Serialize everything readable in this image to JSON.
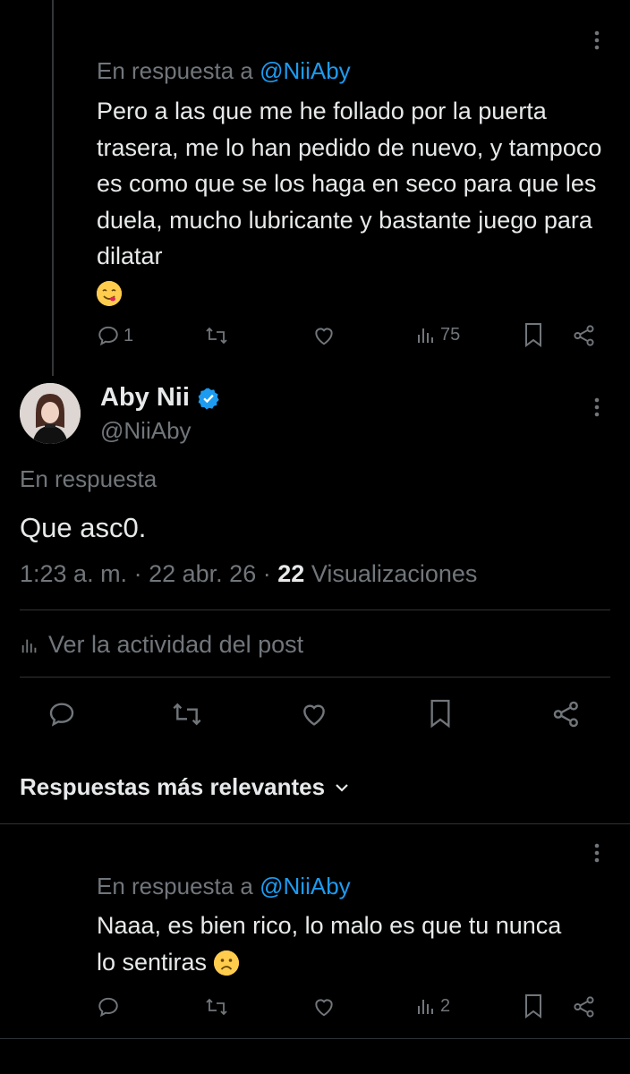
{
  "top_reply": {
    "reply_prefix": "En respuesta a",
    "reply_handle": "@NiiAby",
    "text": "Pero a las que me he follado por la puerta trasera, me lo han pedido de nuevo, y tampoco es como que se los haga en seco para que les duela, mucho lubricante y bastante juego para dilatar",
    "emoji_icon": "savoring-food-face-emoji",
    "actions": {
      "reply_count": "1",
      "repost_count": "",
      "like_count": "",
      "views_count": "75"
    }
  },
  "main_post": {
    "display_name": "Aby Nii",
    "handle": "@NiiAby",
    "verified": true,
    "verified_color": "#1d9bf0",
    "reply_prefix": "En respuesta",
    "text": "Que asc0.",
    "time": "1:23 a. m.",
    "date": "22 abr. 26",
    "views_count": "22",
    "views_label": "Visualizaciones",
    "activity_label": "Ver la actividad del post"
  },
  "replies_sort": {
    "label": "Respuestas más relevantes"
  },
  "bottom_reply": {
    "reply_prefix": "En respuesta a",
    "reply_handle": "@NiiAby",
    "text": "Naaa, es bien rico, lo malo es que tu nunca lo sentiras",
    "emoji_icon": "frowning-face-emoji",
    "actions": {
      "views_count": "2"
    }
  },
  "colors": {
    "background": "#000000",
    "text": "#e7e9ea",
    "muted": "#71767b",
    "accent": "#1d9bf0",
    "divider": "#2f3336"
  }
}
